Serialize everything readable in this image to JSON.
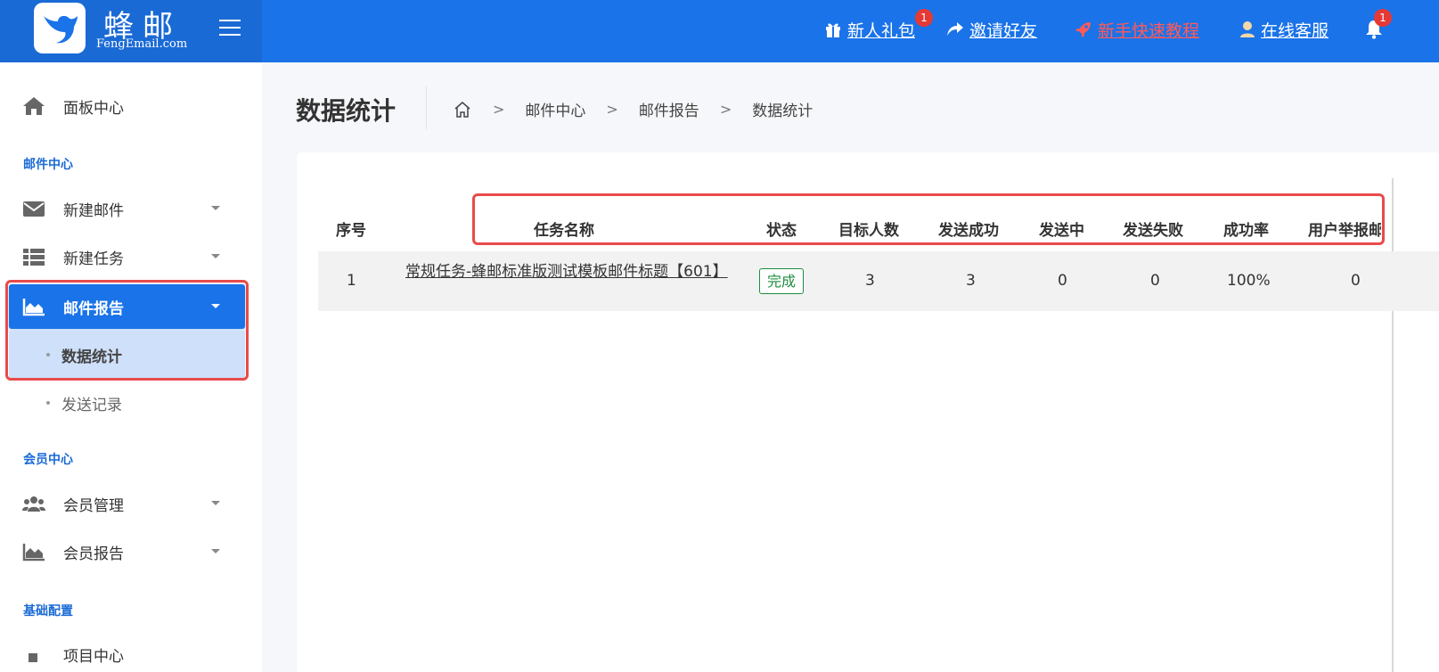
{
  "brand": {
    "name_cn": "蜂邮",
    "name_en": "FengEmail.com"
  },
  "header_links": [
    {
      "label": "新人礼包",
      "icon": "gift-icon",
      "badge": "1"
    },
    {
      "label": "邀请好友",
      "icon": "share-icon"
    },
    {
      "label": "新手快速教程",
      "icon": "rocket-icon",
      "color": "#ff5a5a"
    },
    {
      "label": "在线客服",
      "icon": "user-icon"
    }
  ],
  "notifications": {
    "icon": "bell-icon",
    "badge": "1"
  },
  "sidebar": {
    "dashboard": "面板中心",
    "sections": {
      "mail_center": "邮件中心",
      "member_center": "会员中心",
      "basic_config": "基础配置"
    },
    "items": {
      "new_mail": "新建邮件",
      "new_task": "新建任务",
      "mail_report": "邮件报告",
      "data_stats": "数据统计",
      "send_records": "发送记录",
      "member_manage": "会员管理",
      "member_report": "会员报告",
      "project_center": "项目中心"
    }
  },
  "page": {
    "title": "数据统计",
    "breadcrumb": [
      "邮件中心",
      "邮件报告",
      "数据统计"
    ]
  },
  "table": {
    "headers": [
      "序号",
      "任务名称",
      "状态",
      "目标人数",
      "发送成功",
      "发送中",
      "发送失败",
      "成功率",
      "用户举报邮件"
    ],
    "rows": [
      {
        "index": "1",
        "task_name": "常规任务-蜂邮标准版测试模板邮件标题【601】",
        "status": "完成",
        "target": "3",
        "success": "3",
        "sending": "0",
        "failed": "0",
        "rate": "100%",
        "reports": "0"
      }
    ]
  },
  "colors": {
    "header": "#1a73e8",
    "accent": "#1a73e8",
    "highlight_box": "#e94b4b",
    "status_done": "#1e8e3e"
  }
}
